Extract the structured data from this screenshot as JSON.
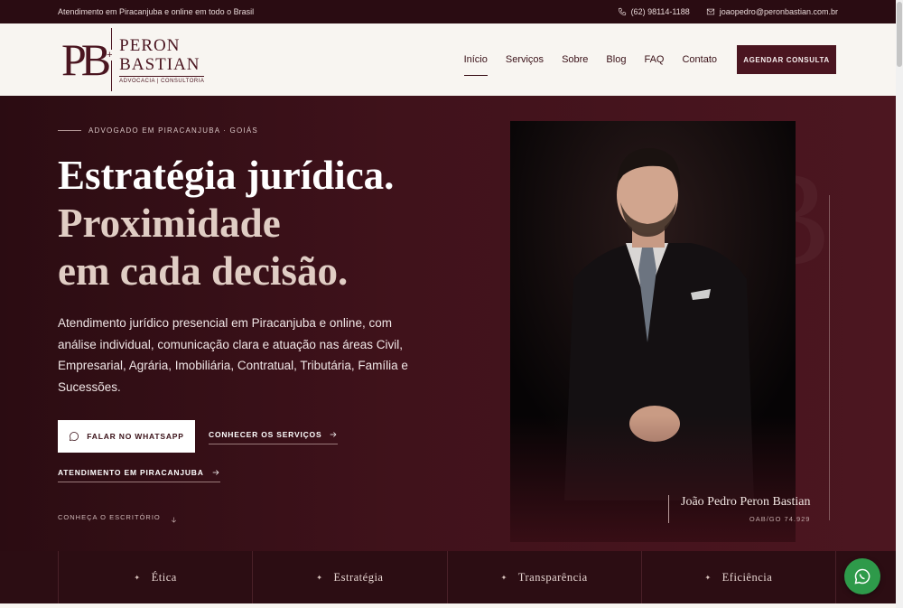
{
  "topbar": {
    "message": "Atendimento em Piracanjuba e online em todo o Brasil",
    "phone": "(62) 98114-1188",
    "email": "joaopedro@peronbastian.com.br"
  },
  "logo": {
    "monogram": "PB",
    "name_line1": "PERON",
    "name_line2": "BASTIAN",
    "subtitle": "ADVOCACIA | CONSULTORIA"
  },
  "nav": {
    "items": [
      {
        "label": "Início"
      },
      {
        "label": "Serviços"
      },
      {
        "label": "Sobre"
      },
      {
        "label": "Blog"
      },
      {
        "label": "FAQ"
      },
      {
        "label": "Contato"
      }
    ],
    "cta_label": "AGENDAR CONSULTA"
  },
  "hero": {
    "eyebrow": "ADVOGADO EM PIRACANJUBA · GOIÁS",
    "headline_line1": "Estratégia jurídica.",
    "headline_line2": "Proximidade",
    "headline_line3": "em cada decisão.",
    "lead": "Atendimento jurídico presencial em Piracanjuba e online, com análise individual, comunicação clara e atuação nas áreas Civil, Empresarial, Agrária, Imobiliária, Contratual, Tributária, Família e Sucessões.",
    "whatsapp_label": "FALAR NO WHATSAPP",
    "services_label": "CONHECER OS SERVIÇOS",
    "local_label": "ATENDIMENTO EM PIRACANJUBA",
    "scroll_label": "CONHEÇA O ESCRITÓRIO",
    "photo_name": "João Pedro Peron Bastian",
    "photo_oab": "OAB/GO 74.929"
  },
  "values": [
    {
      "label": "Ética"
    },
    {
      "label": "Estratégia"
    },
    {
      "label": "Transparência"
    },
    {
      "label": "Eficiência"
    }
  ],
  "colors": {
    "brand": "#4a1520",
    "dark": "#2a0c12",
    "cream": "#f8f5f1",
    "whatsapp": "#2e9a4a"
  }
}
